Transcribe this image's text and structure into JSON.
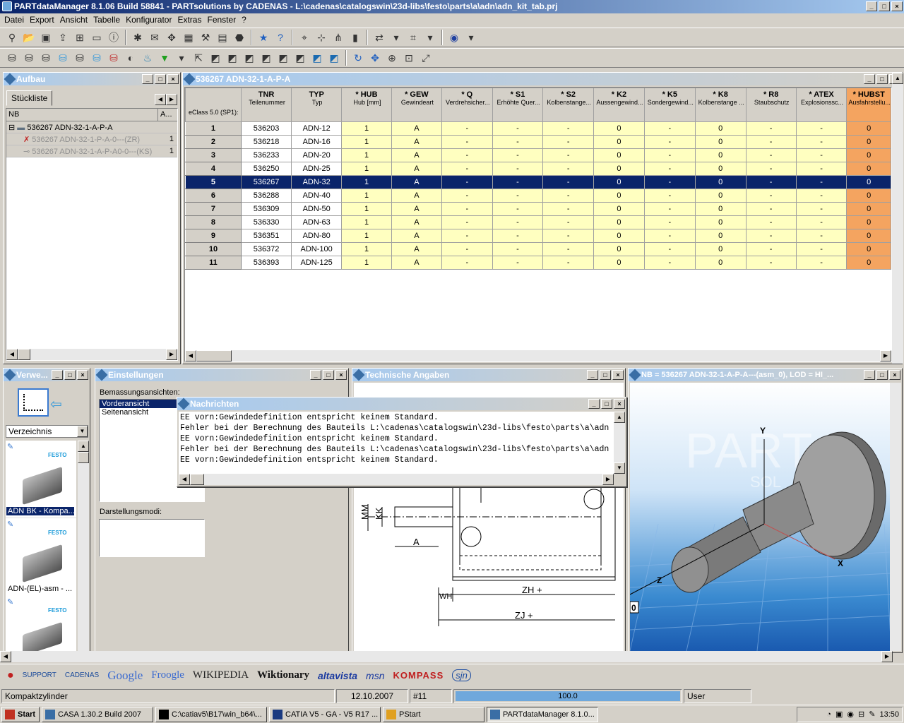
{
  "app": {
    "title": "PARTdataManager 8.1.06 Build 58841 - PARTsolutions by CADENAS - L:\\cadenas\\catalogswin\\23d-libs\\festo\\parts\\a\\adn\\adn_kit_tab.prj"
  },
  "menu": [
    "Datei",
    "Export",
    "Ansicht",
    "Tabelle",
    "Konfigurator",
    "Extras",
    "Fenster",
    "?"
  ],
  "aufbau": {
    "title": "Aufbau",
    "tab": "Stückliste",
    "col_nb": "NB",
    "col_a": "A...",
    "rows": [
      {
        "label": "536267 ADN-32-1-A-P-A",
        "qty": ""
      },
      {
        "label": "536267 ADN-32-1-P-A-0---(ZR)",
        "qty": "1"
      },
      {
        "label": "536267 ADN-32-1-A-P-A0-0---(KS)",
        "qty": "1"
      }
    ]
  },
  "table": {
    "title": "536267 ADN-32-1-A-P-A",
    "eclass": "eClass 5.0 (SP1):",
    "headers": [
      {
        "code": "TNR",
        "desc": "Teilenummer"
      },
      {
        "code": "TYP",
        "desc": "Typ"
      },
      {
        "code": "* HUB",
        "desc": "Hub [mm]"
      },
      {
        "code": "* GEW",
        "desc": "Gewindeart"
      },
      {
        "code": "* Q",
        "desc": "Verdrehsicher..."
      },
      {
        "code": "* S1",
        "desc": "Erhöhte Quer..."
      },
      {
        "code": "* S2",
        "desc": "Kolbenstange..."
      },
      {
        "code": "* K2",
        "desc": "Aussengewind..."
      },
      {
        "code": "* K5",
        "desc": "Sondergewind..."
      },
      {
        "code": "* K8",
        "desc": "Kolbenstange ..."
      },
      {
        "code": "* R8",
        "desc": "Staubschutz"
      },
      {
        "code": "* ATEX",
        "desc": "Explosionssc..."
      },
      {
        "code": "* HUBST",
        "desc": "Ausfahrstellu..."
      }
    ],
    "rows": [
      [
        "1",
        "536203",
        "ADN-12",
        "1",
        "A",
        "-",
        "-",
        "-",
        "0",
        "-",
        "0",
        "-",
        "-",
        "0"
      ],
      [
        "2",
        "536218",
        "ADN-16",
        "1",
        "A",
        "-",
        "-",
        "-",
        "0",
        "-",
        "0",
        "-",
        "-",
        "0"
      ],
      [
        "3",
        "536233",
        "ADN-20",
        "1",
        "A",
        "-",
        "-",
        "-",
        "0",
        "-",
        "0",
        "-",
        "-",
        "0"
      ],
      [
        "4",
        "536250",
        "ADN-25",
        "1",
        "A",
        "-",
        "-",
        "-",
        "0",
        "-",
        "0",
        "-",
        "-",
        "0"
      ],
      [
        "5",
        "536267",
        "ADN-32",
        "1",
        "A",
        "-",
        "-",
        "-",
        "0",
        "-",
        "0",
        "-",
        "-",
        "0"
      ],
      [
        "6",
        "536288",
        "ADN-40",
        "1",
        "A",
        "-",
        "-",
        "-",
        "0",
        "-",
        "0",
        "-",
        "-",
        "0"
      ],
      [
        "7",
        "536309",
        "ADN-50",
        "1",
        "A",
        "-",
        "-",
        "-",
        "0",
        "-",
        "0",
        "-",
        "-",
        "0"
      ],
      [
        "8",
        "536330",
        "ADN-63",
        "1",
        "A",
        "-",
        "-",
        "-",
        "0",
        "-",
        "0",
        "-",
        "-",
        "0"
      ],
      [
        "9",
        "536351",
        "ADN-80",
        "1",
        "A",
        "-",
        "-",
        "-",
        "0",
        "-",
        "0",
        "-",
        "-",
        "0"
      ],
      [
        "10",
        "536372",
        "ADN-100",
        "1",
        "A",
        "-",
        "-",
        "-",
        "0",
        "-",
        "0",
        "-",
        "-",
        "0"
      ],
      [
        "11",
        "536393",
        "ADN-125",
        "1",
        "A",
        "-",
        "-",
        "-",
        "0",
        "-",
        "0",
        "-",
        "-",
        "0"
      ]
    ],
    "selected_row": "5"
  },
  "verweis": {
    "title": "Verwe...",
    "dropdown": "Verzeichnis",
    "brand": "FESTO",
    "items": [
      "ADN BK - Kompa...",
      "ADN-(EL)-asm - ..."
    ]
  },
  "einstellungen": {
    "title": "Einstellungen",
    "label_views": "Bemassungsansichten:",
    "views": [
      "Vorderansicht",
      "Seitenansicht"
    ],
    "label_modes": "Darstellungsmodi:"
  },
  "technische": {
    "title": "Technische Angaben",
    "dims": [
      "MM",
      "KK",
      "A",
      "WH",
      "ZH +",
      "ZJ +"
    ]
  },
  "nachrichten": {
    "title": "Nachrichten",
    "lines": [
      "EE vorn:Gewindedefinition entspricht keinem Standard.",
      "Fehler bei der Berechnung des Bauteils L:\\cadenas\\catalogswin\\23d-libs\\festo\\parts\\a\\adn",
      "EE vorn:Gewindedefinition entspricht keinem Standard.",
      "Fehler bei der Berechnung des Bauteils L:\\cadenas\\catalogswin\\23d-libs\\festo\\parts\\a\\adn",
      "EE vorn:Gewindedefinition entspricht keinem Standard."
    ]
  },
  "view3d": {
    "title": "NB = 536267 ADN-32-1-A-P-A---(asm_0), LOD = HI_...",
    "watermark": "PART",
    "watermark2": "SOL",
    "axis_y": "Y",
    "axis_x": "X",
    "axis_z": "Z",
    "corner": "0"
  },
  "links": [
    "SUPPORT",
    "CADENAS",
    "Google",
    "Froogle",
    "WIKIPEDIA",
    "Wiktionary",
    "altavista",
    "msn",
    "KOMPASS",
    "sjn"
  ],
  "status": {
    "text": "Kompaktzylinder",
    "date": "12.10.2007",
    "num": "#11",
    "progress": "100.0",
    "user": "User"
  },
  "taskbar": {
    "start": "Start",
    "items": [
      "CASA 1.30.2 Build 2007",
      "C:\\catiav5\\B17\\win_b64\\...",
      "CATIA V5 - GA - V5 R17 ...",
      "PStart",
      "PARTdataManager 8.1.0..."
    ],
    "time": "13:50"
  }
}
